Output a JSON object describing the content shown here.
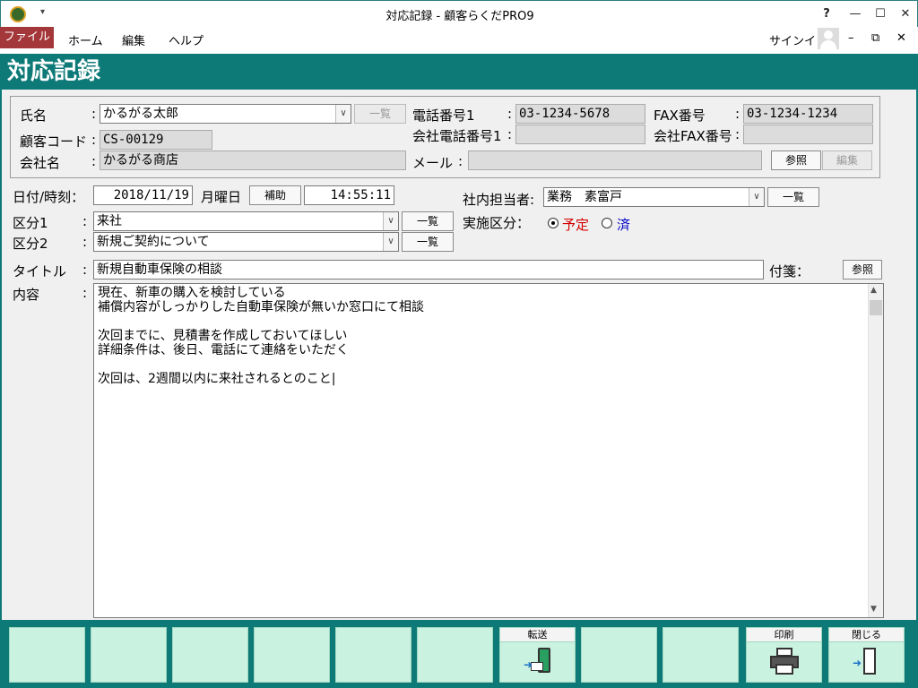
{
  "window": {
    "title": "対応記録 - 顧客らくだPRO9",
    "help": "?",
    "minimize": "—",
    "maximize": "☐",
    "close": "✕"
  },
  "menu": {
    "file": "ファイル",
    "home": "ホーム",
    "edit": "編集",
    "help": "ヘルプ",
    "signin": "サインイン",
    "mdi_min": "–",
    "mdi_restore": "⧉",
    "mdi_close": "✕"
  },
  "header": {
    "title": "対応記録"
  },
  "customer": {
    "name_label": "氏名",
    "name_value": "かるがる太郎",
    "list_btn": "一覧",
    "code_label": "顧客コード",
    "code_value": "CS-00129",
    "company_label": "会社名",
    "company_value": "かるがる商店",
    "tel1_label": "電話番号1",
    "tel1_value": "03-1234-5678",
    "company_tel1_label": "会社電話番号1",
    "company_tel1_value": "",
    "fax_label": "FAX番号",
    "fax_value": "03-1234-1234",
    "company_fax_label": "会社FAX番号",
    "company_fax_value": "",
    "mail_label": "メール",
    "mail_value": "",
    "ref_btn": "参照",
    "edit_btn": "編集"
  },
  "record": {
    "date_label": "日付/時刻",
    "date_value": "2018/11/19",
    "weekday": "月曜日",
    "assist_btn": "補助",
    "time_value": "14:55:11",
    "staff_label": "社内担当者",
    "staff_value": "業務　素富戸",
    "staff_list_btn": "一覧",
    "cat1_label": "区分1",
    "cat1_value": "来社",
    "cat1_list_btn": "一覧",
    "cat2_label": "区分2",
    "cat2_value": "新規ご契約について",
    "cat2_list_btn": "一覧",
    "exec_label": "実施区分",
    "exec_opt1": "予定",
    "exec_opt2": "済",
    "title_label": "タイトル",
    "title_value": "新規自動車保険の相談",
    "tag_label": "付箋",
    "tag_ref_btn": "参照",
    "content_label": "内容",
    "content_lines": [
      "現在、新車の購入を検討している",
      "補償内容がしっかりした自動車保険が無いか窓口にて相談",
      "",
      "次回までに、見積書を作成しておいてほしい",
      "詳細条件は、後日、電話にて連絡をいただく",
      "",
      "次回は、2週間以内に来社されるとのこと|"
    ]
  },
  "footer": {
    "forward": "転送",
    "print": "印刷",
    "close": "閉じる"
  },
  "colors": {
    "accent": "#0e7a78",
    "fkey": "#c9f3e0",
    "file_menu": "#a4373a",
    "radio_yotei": "#d40000",
    "radio_sumi": "#0000c8"
  }
}
